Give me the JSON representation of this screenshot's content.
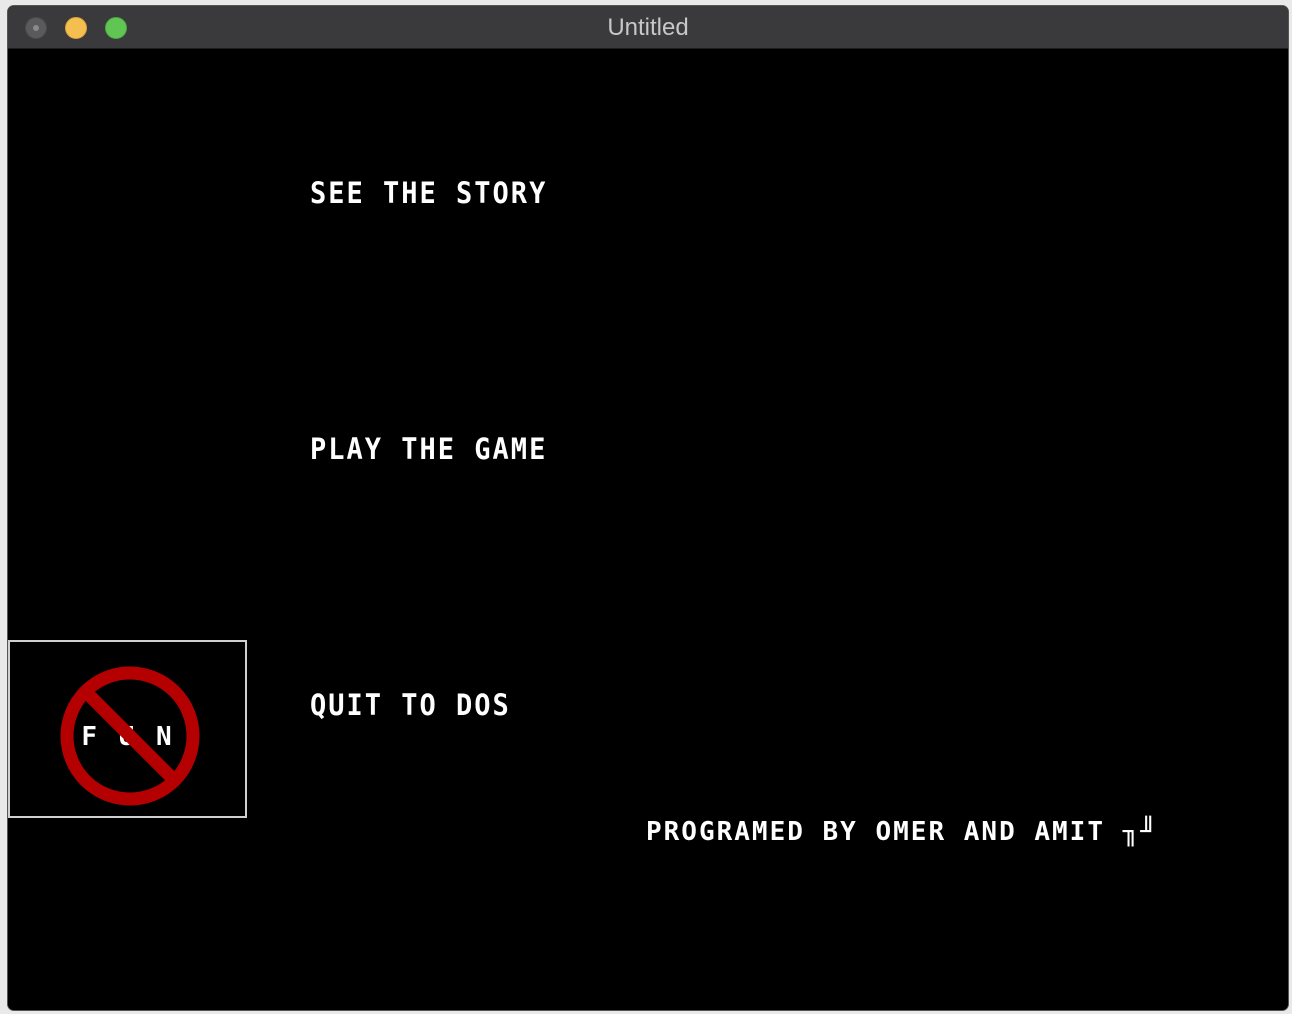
{
  "window": {
    "title": "Untitled"
  },
  "menu": {
    "items": [
      {
        "label": "SEE THE STORY"
      },
      {
        "label": "PLAY THE GAME"
      },
      {
        "label": "QUIT TO DOS"
      }
    ]
  },
  "credits": {
    "text": "PROGRAMED BY OMER AND AMIT ╖╜"
  },
  "logo": {
    "text": "F U N",
    "icon": "no-fun-prohibition-icon",
    "ring_color": "#b40000",
    "text_color": "#ffffff"
  },
  "colors": {
    "background": "#000000",
    "text": "#ffffff",
    "titlebar": "#3a3a3c"
  }
}
